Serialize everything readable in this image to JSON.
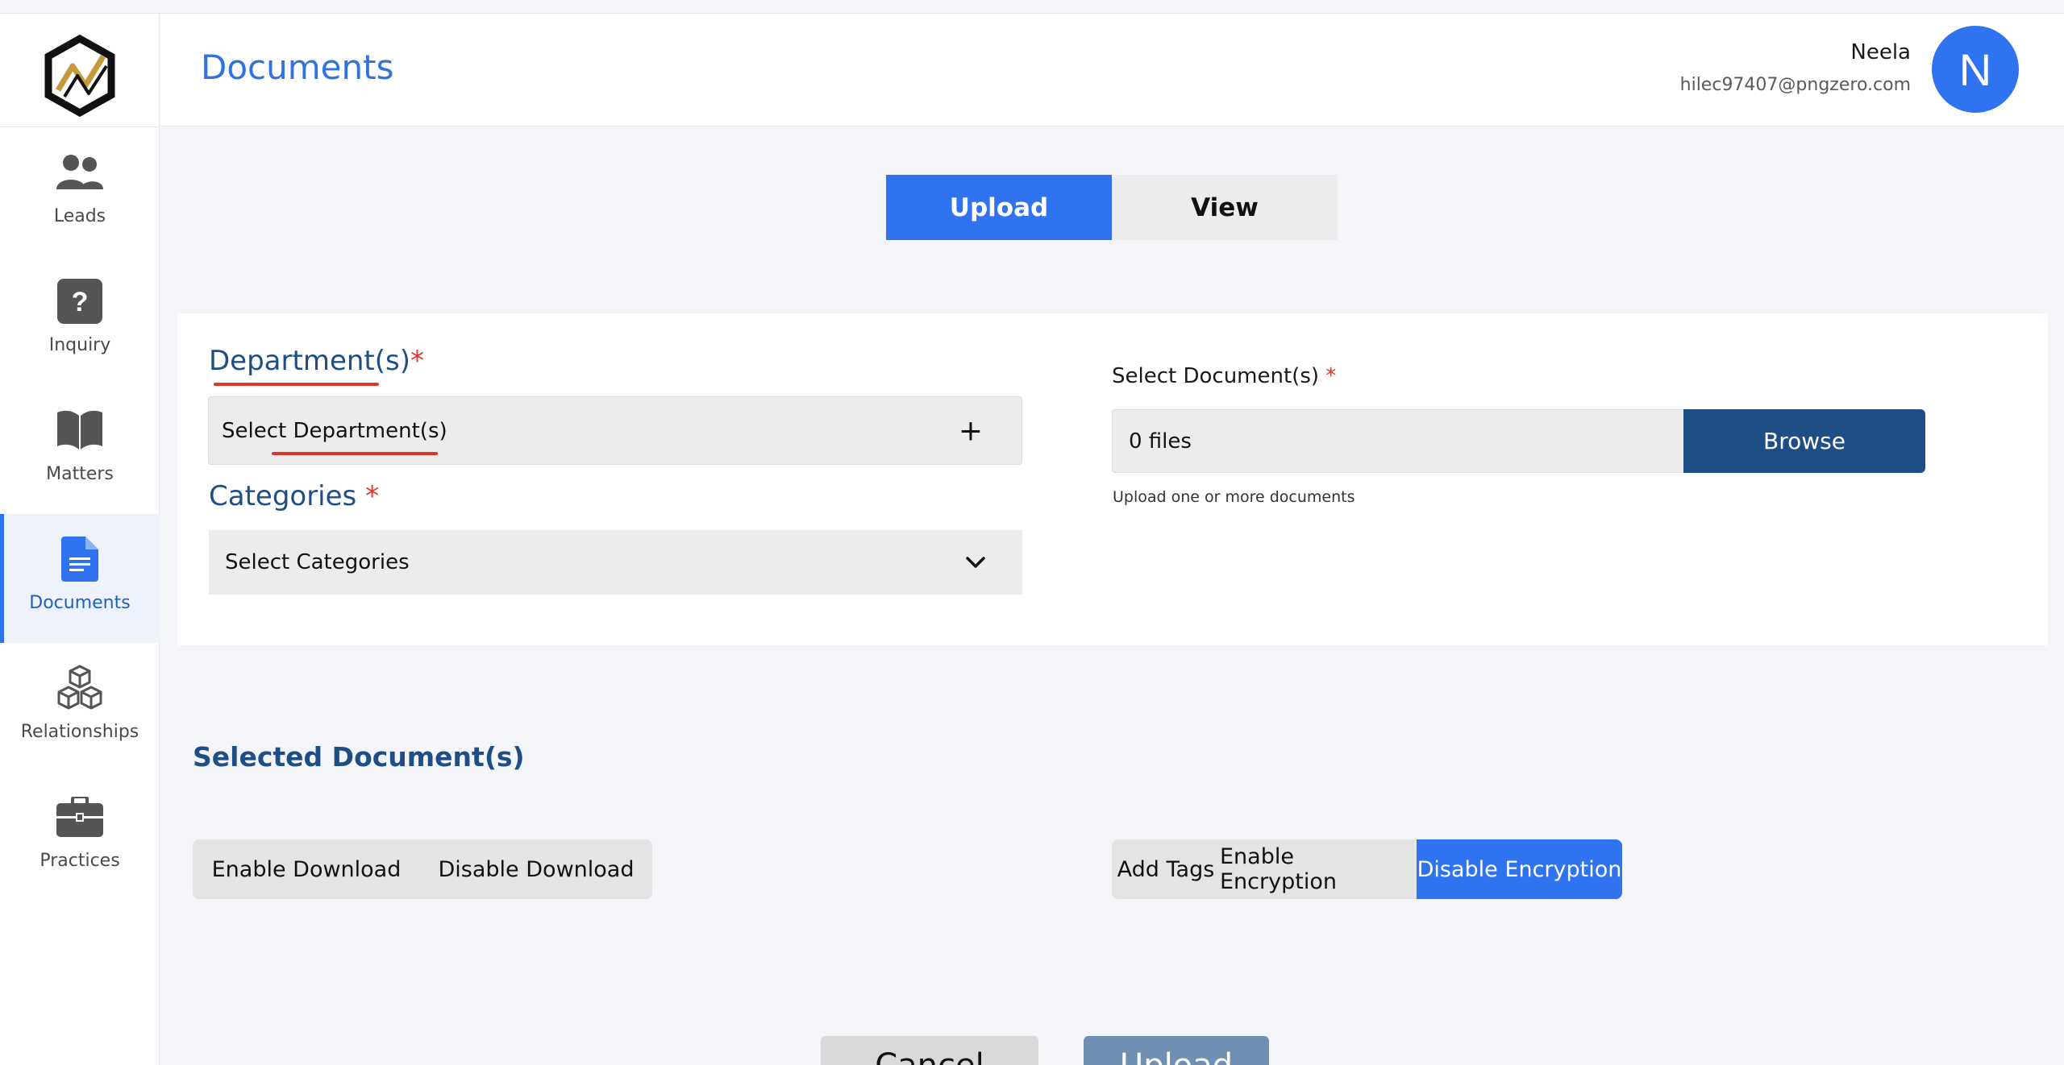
{
  "header": {
    "title": "Documents",
    "user_name": "Neela",
    "user_email": "hilec97407@pngzero.com",
    "avatar_initial": "N"
  },
  "sidebar": {
    "items": [
      {
        "label": "Leads",
        "icon": "users-icon"
      },
      {
        "label": "Inquiry",
        "icon": "question-icon"
      },
      {
        "label": "Matters",
        "icon": "book-icon"
      },
      {
        "label": "Documents",
        "icon": "document-icon",
        "active": true
      },
      {
        "label": "Relationships",
        "icon": "cubes-icon"
      },
      {
        "label": "Practices",
        "icon": "briefcase-icon"
      }
    ]
  },
  "tabs": {
    "upload": "Upload",
    "view": "View",
    "active": "Upload"
  },
  "form": {
    "department_title": "Department(s)",
    "department_required": "*",
    "department_placeholder": "Select Department(s)",
    "department_action": "+",
    "categories_title": "Categories",
    "categories_required": "*",
    "categories_placeholder": "Select Categories",
    "documents_label": "Select Document(s)",
    "documents_required": "*",
    "files_value": "0 files",
    "browse_label": "Browse",
    "help_text": "Upload one or more documents"
  },
  "selected": {
    "title": "Selected Document(s)",
    "enable_download": "Enable Download",
    "disable_download": "Disable Download",
    "add_tags": "Add Tags",
    "enable_encryption": "Enable Encryption",
    "disable_encryption": "Disable Encryption"
  },
  "footer": {
    "cancel": "Cancel",
    "upload": "Upload"
  },
  "colors": {
    "primary": "#2f73f0",
    "navy": "#1f4e86",
    "required": "#e0352b"
  }
}
